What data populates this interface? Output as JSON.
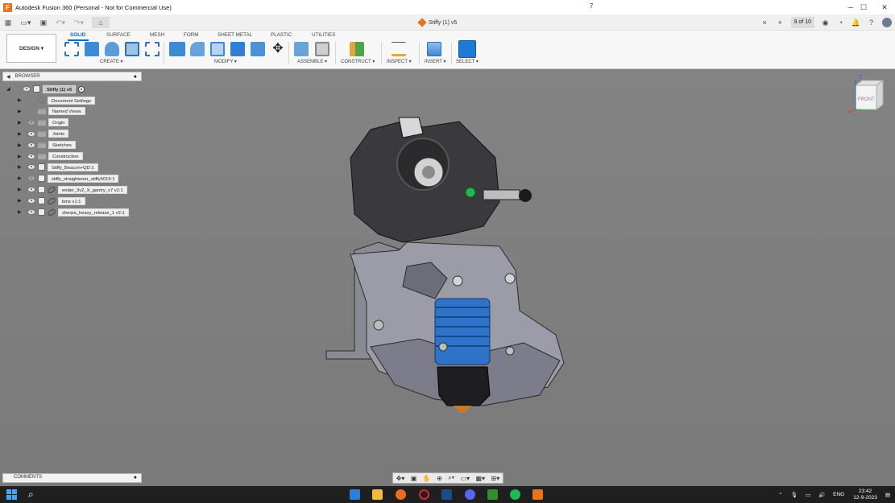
{
  "window": {
    "title": "Autodesk Fusion 360 (Personal - Not for Commercial Use)",
    "app_icon_letter": "F",
    "notification_count": "7",
    "controls": [
      "minimize",
      "maximize",
      "close"
    ]
  },
  "quick_access": {
    "icons": [
      "grid-icon",
      "file-icon",
      "save-icon",
      "undo-icon",
      "redo-icon",
      "home-icon"
    ]
  },
  "document_tab": {
    "name": "Stiffy (1) v5",
    "close_glyph": "×",
    "pager": "9 of 10"
  },
  "ribbon": {
    "workspace": "DESIGN ▾",
    "tabs": [
      "SOLID",
      "SURFACE",
      "MESH",
      "FORM",
      "SHEET METAL",
      "PLASTIC",
      "UTILITIES"
    ],
    "active_tab": "SOLID",
    "groups": [
      {
        "label": "CREATE ▾"
      },
      {
        "label": "MODIFY ▾"
      },
      {
        "label": "ASSEMBLE ▾"
      },
      {
        "label": "CONSTRUCT ▾"
      },
      {
        "label": "INSPECT ▾"
      },
      {
        "label": "INSERT ▾"
      },
      {
        "label": "SELECT ▾"
      }
    ],
    "accent": "#0a6ebd"
  },
  "browser": {
    "header": "BROWSER",
    "root": "Stiffy (1) v5",
    "items": [
      {
        "label": "Document Settings",
        "kind": "gear",
        "eye": false
      },
      {
        "label": "Named Views",
        "kind": "folder",
        "eye": false
      },
      {
        "label": "Origin",
        "kind": "folder",
        "eye": true,
        "eye_hidden": true
      },
      {
        "label": "Joints",
        "kind": "folder",
        "eye": true
      },
      {
        "label": "Sketches",
        "kind": "folder",
        "eye": true
      },
      {
        "label": "Construction",
        "kind": "folder",
        "eye": true
      },
      {
        "label": "Stiffy_Beacon+QD:1",
        "kind": "comp",
        "eye": true
      },
      {
        "label": "stiffy_straightener_stiffy5015:1",
        "kind": "comp",
        "eye": true,
        "eye_hidden": true
      },
      {
        "label": "ender_3v2_X_gantry_v7 v1:1",
        "kind": "link",
        "eye": true
      },
      {
        "label": "bms v1:1",
        "kind": "link",
        "eye": true
      },
      {
        "label": "sherpa_heavy_release_1 v2:1",
        "kind": "link",
        "eye": true
      }
    ]
  },
  "viewcube": {
    "face": "FRONT",
    "axis_z": "Z",
    "axis_x": "X"
  },
  "comments": {
    "header": "COMMENTS"
  },
  "navbar": {
    "icons": [
      "orbit-icon",
      "look-at-icon",
      "pan-icon",
      "zoom-icon",
      "fit-icon",
      "display-settings-icon",
      "grid-settings-icon",
      "viewports-icon"
    ]
  },
  "taskbar": {
    "lang": "ENG",
    "time": "23:42",
    "date": "12-9-2023",
    "tray_icons": [
      "chevron-up-icon",
      "mic-icon",
      "network-icon",
      "volume-icon"
    ],
    "apps": [
      "file-explorer",
      "folder",
      "origin",
      "opera",
      "steam",
      "discord",
      "xbox",
      "spotify",
      "fusion"
    ]
  }
}
